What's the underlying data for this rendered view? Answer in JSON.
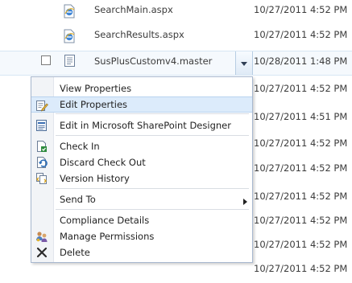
{
  "files": [
    {
      "name": "SearchMain.aspx",
      "modified": "10/27/2011 4:52 PM"
    },
    {
      "name": "SearchResults.aspx",
      "modified": "10/27/2011 4:52 PM"
    },
    {
      "name": "SusPlusCustomv4.master",
      "modified": "10/28/2011 1:48 PM"
    }
  ],
  "background_dates": [
    "10/27/2011 4:52 PM",
    "10/27/2011 4:51 PM",
    "10/27/2011 4:52 PM",
    "10/27/2011 4:52 PM",
    "10/27/2011 4:52 PM",
    "10/27/2011 4:52 PM",
    "10/27/2011 4:52 PM",
    "10/27/2011 4:52 PM"
  ],
  "context_menu": {
    "view_properties": "View Properties",
    "edit_properties": "Edit Properties",
    "edit_in_designer": "Edit in Microsoft SharePoint Designer",
    "check_in": "Check In",
    "discard_check_out": "Discard Check Out",
    "version_history": "Version History",
    "send_to": "Send To",
    "compliance_details": "Compliance Details",
    "manage_permissions": "Manage Permissions",
    "delete": "Delete"
  },
  "colors": {
    "highlight": "#dcebfb",
    "menu_border": "#a8b8cf",
    "accent": "#2a6bb6"
  }
}
